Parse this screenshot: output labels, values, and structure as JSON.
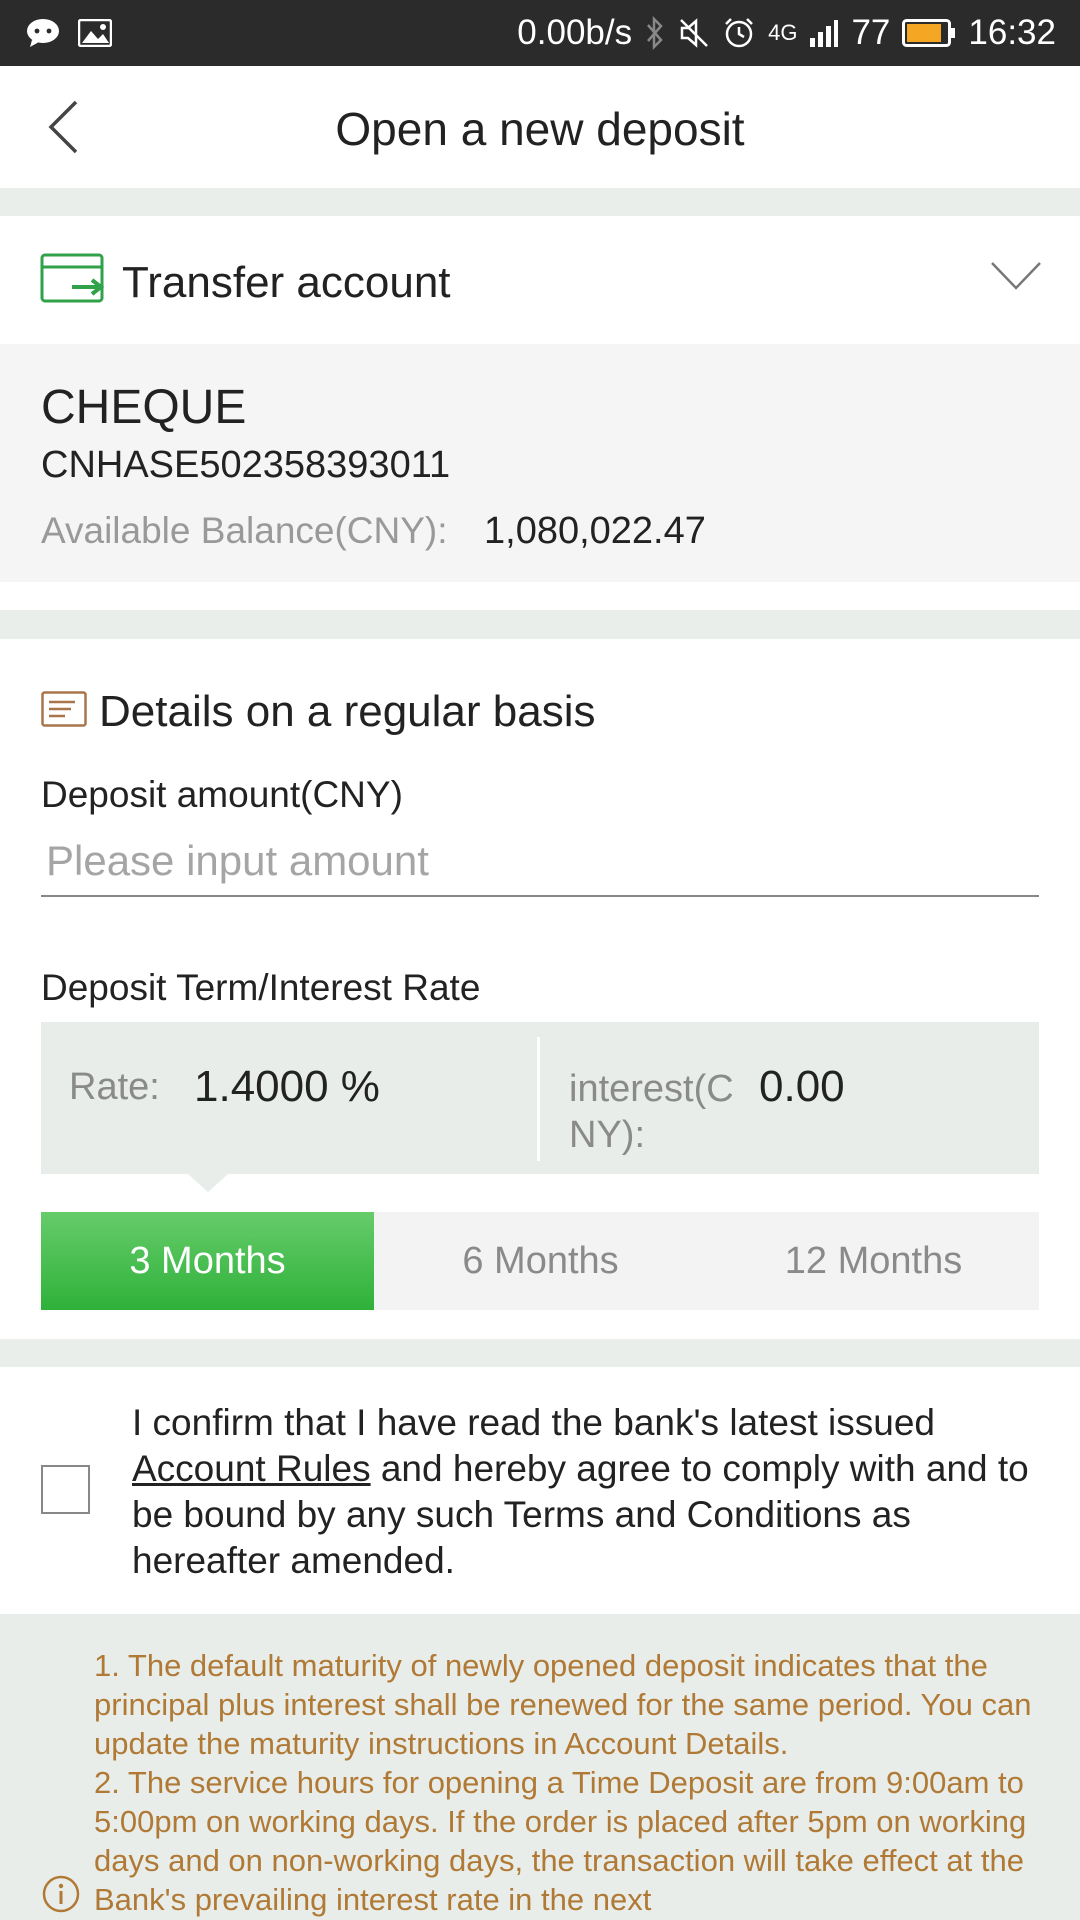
{
  "status_bar": {
    "speed": "0.00b/s",
    "network": "4G",
    "battery": "77",
    "time": "16:32",
    "icons": [
      "message-icon",
      "image-icon",
      "bluetooth-icon",
      "mute-icon",
      "alarm-icon",
      "signal-icon",
      "battery-icon"
    ]
  },
  "header": {
    "title": "Open a new deposit",
    "back_icon": "chevron-left-icon"
  },
  "transfer": {
    "label": "Transfer account",
    "icon": "transfer-card-icon",
    "expand_icon": "chevron-down-icon"
  },
  "account": {
    "type": "CHEQUE",
    "number": "CNHASE502358393011",
    "balance_label": "Available Balance(CNY):",
    "balance_value": "1,080,022.47"
  },
  "details": {
    "title": "Details on a regular basis",
    "icon": "document-icon",
    "amount_label": "Deposit amount(CNY)",
    "amount_placeholder": "Please input amount",
    "amount_value": "",
    "term_label": "Deposit Term/Interest Rate",
    "rate_label": "Rate:",
    "rate_value": "1.4000 %",
    "interest_label": "interest(CNY):",
    "interest_value": "0.00",
    "terms": [
      {
        "label": "3 Months",
        "selected": true
      },
      {
        "label": "6 Months",
        "selected": false
      },
      {
        "label": "12 Months",
        "selected": false
      }
    ]
  },
  "consent": {
    "checked": false,
    "text_before": "I confirm that I have read the bank's latest issued ",
    "link_text": "Account Rules",
    "text_after": " and hereby agree to comply with and to be bound by any such Terms and Conditions as hereafter amended."
  },
  "notes": {
    "icon": "info-icon",
    "items": [
      "1. The default maturity of newly opened deposit indicates that the principal plus interest shall be renewed for the same period. You can update the maturity instructions in Account Details.",
      "2. The service hours for opening a Time Deposit are from 9:00am to 5:00pm on working days. If the order is placed after 5pm on working days and on non-working days, the transaction will take effect at the Bank's prevailing interest rate in the next"
    ]
  },
  "colors": {
    "accent_green": "#2fb13a",
    "note_text": "#b07a36",
    "panel_bg": "#e8ede9"
  }
}
